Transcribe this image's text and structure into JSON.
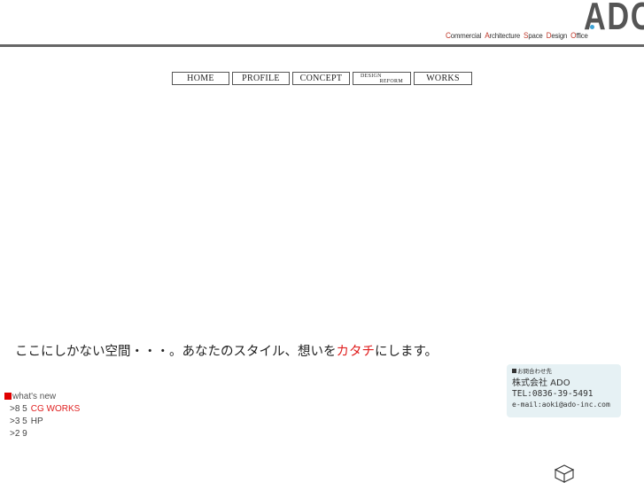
{
  "header": {
    "tagline": [
      {
        "cap": "C",
        "rest": "ommercial"
      },
      {
        "cap": "A",
        "rest": "rchitecture"
      },
      {
        "cap": "S",
        "rest": "pace"
      },
      {
        "cap": "D",
        "rest": "esign"
      },
      {
        "cap": "O",
        "rest": "ffice"
      }
    ],
    "logo_text": "ADO",
    "logo_accent_color": "#3ea3d6"
  },
  "nav": {
    "home": "HOME",
    "profile": "PROFILE",
    "concept": "CONCEPT",
    "design_line1": "DESIGN",
    "design_line2": "REFORM",
    "works": "WORKS"
  },
  "catchphrase": {
    "before": "ここにしかない空間・・・。あなたのスタイル、想いを",
    "accent": "カタチ",
    "after": "にします。",
    "accent_color": "#e02020"
  },
  "news": {
    "heading": "what's new",
    "items": [
      {
        "date": ">8 5",
        "title": "CG WORKS",
        "linked": true
      },
      {
        "date": ">3 5",
        "title": "HP",
        "linked": false
      },
      {
        "date": ">2 9",
        "title": "",
        "linked": false
      }
    ]
  },
  "contact": {
    "label": "お問合わせ先",
    "company": "株式会社 ADO",
    "tel": "TEL:0836-39-5491",
    "email": "e-mail:aoki@ado-inc.com"
  },
  "footer": {
    "icon": "cube-icon"
  }
}
